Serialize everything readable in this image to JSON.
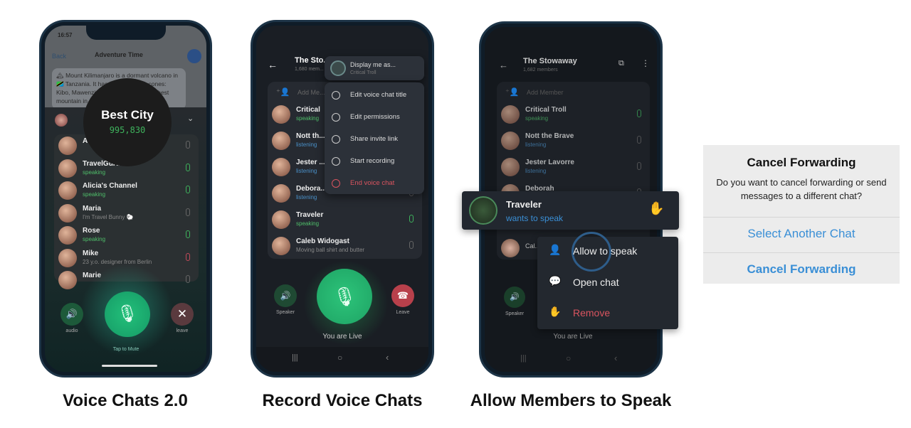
{
  "captions": [
    "Voice Chats 2.0",
    "Record Voice Chats",
    "Allow Members to Speak"
  ],
  "phone1": {
    "time": "16:57",
    "back": "Back",
    "chat_title": "Adventure Time",
    "message": "🏔 Mount Kilimanjaro is a dormant volcano in 🇹🇿 Tanzania. It has three volcanic cones: Kibo, Mawenzi, and Shira. It is the highest mountain in Africa",
    "voice_chat_title": "Best City",
    "listeners": "995,830",
    "participants": [
      {
        "name": "Adv...",
        "status": "",
        "state": "muted",
        "mic": "off"
      },
      {
        "name": "TravelGuru",
        "status": "speaking",
        "state": "speak",
        "mic": "on",
        "verified": true
      },
      {
        "name": "Alicia's Channel",
        "status": "speaking",
        "state": "speak",
        "mic": "on"
      },
      {
        "name": "Maria",
        "status": "I'm Travel Bunny 🐑",
        "state": "muted",
        "mic": "off"
      },
      {
        "name": "Rose",
        "status": "speaking",
        "state": "speak",
        "mic": "on"
      },
      {
        "name": "Mike",
        "status": "23 y.o. designer from Berlin",
        "state": "muted",
        "mic": "red"
      },
      {
        "name": "Marie",
        "status": "",
        "state": "muted",
        "mic": "off"
      }
    ],
    "audio_label": "audio",
    "leave_label": "leave",
    "mute_hint": "Tap to Mute"
  },
  "phone2": {
    "title": "The Sto...",
    "subtitle": "1,680 mem...",
    "add_member": "Add Me...",
    "participants": [
      {
        "name": "Critical",
        "status": "speaking",
        "state": "speak",
        "mic": "on"
      },
      {
        "name": "Nott th...",
        "status": "listening",
        "state": "listen",
        "mic": "off"
      },
      {
        "name": "Jester ...",
        "status": "listening",
        "state": "listen",
        "mic": "off"
      },
      {
        "name": "Debora...",
        "status": "listening",
        "state": "listen",
        "mic": "off"
      },
      {
        "name": "Traveler",
        "status": "speaking",
        "state": "speak",
        "mic": "on"
      },
      {
        "name": "Caleb Widogast",
        "status": "Moving ball shirt and butter",
        "state": "muted",
        "mic": "off"
      }
    ],
    "menu": {
      "display_as": "Display me as...",
      "display_as_sub": "Critical Troll",
      "items": [
        "Edit voice chat title",
        "Edit permissions",
        "Share invite link",
        "Start recording",
        "End voice chat"
      ]
    },
    "speaker_label": "Speaker",
    "leave_label": "Leave",
    "live": "You are Live"
  },
  "phone3": {
    "title": "The Stowaway",
    "subtitle": "1,682 members",
    "add_member": "Add Member",
    "participants": [
      {
        "name": "Critical Troll",
        "status": "speaking",
        "state": "speak",
        "mic": "on"
      },
      {
        "name": "Nott the Brave",
        "status": "listening",
        "state": "listen",
        "mic": "off"
      },
      {
        "name": "Jester Lavorre",
        "status": "listening",
        "state": "listen",
        "mic": "off"
      },
      {
        "name": "Deborah",
        "status": "",
        "state": "muted",
        "mic": "off"
      }
    ],
    "request": {
      "name": "Traveler",
      "status": "wants to speak"
    },
    "cal": "Cal...",
    "menu": [
      "Allow to speak",
      "Open chat",
      "Remove"
    ],
    "speaker_label": "Speaker",
    "live": "You are Live"
  },
  "dialog": {
    "title": "Cancel Forwarding",
    "message": "Do you want to cancel forwarding or send messages to a different chat?",
    "primary": "Select Another Chat",
    "secondary": "Cancel Forwarding"
  },
  "colors": {
    "green": "#3eb25c",
    "blue": "#3a8fd6",
    "red": "#d9545f"
  }
}
